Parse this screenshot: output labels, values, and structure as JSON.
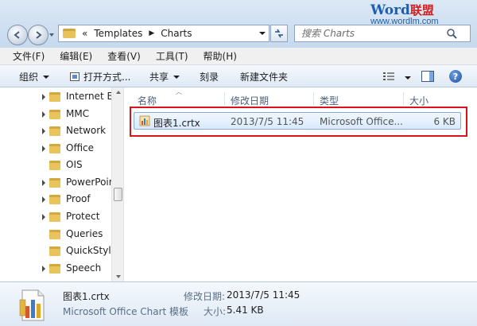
{
  "logo": {
    "brand_word": "Word",
    "brand_cn": "联盟",
    "url": "www.wordlm.com"
  },
  "address": {
    "overflow": "«",
    "crumbs": [
      "Templates",
      "Charts"
    ]
  },
  "search": {
    "placeholder": "搜索 Charts"
  },
  "menu": [
    "文件(F)",
    "编辑(E)",
    "查看(V)",
    "工具(T)",
    "帮助(H)"
  ],
  "toolbar": {
    "organize": "组织",
    "open_with": "打开方式...",
    "share": "共享",
    "burn": "刻录",
    "new_folder": "新建文件夹"
  },
  "nav_items": [
    "Internet Ex",
    "MMC",
    "Network",
    "Office",
    "OIS",
    "PowerPoir",
    "Proof",
    "Protect",
    "Queries",
    "QuickStyle",
    "Speech"
  ],
  "columns": {
    "name": "名称",
    "modified": "修改日期",
    "type": "类型",
    "size": "大小"
  },
  "file": {
    "name": "图表1.crtx",
    "modified": "2013/7/5 11:45",
    "type": "Microsoft Office...",
    "size": "6 KB"
  },
  "details": {
    "file_name": "图表1.crtx",
    "file_type": "Microsoft Office Chart 模板",
    "modified_label": "修改日期:",
    "modified_value": "2013/7/5 11:45",
    "size_label": "大小:",
    "size_value": "5.41 KB"
  },
  "colors": {
    "highlight_border": "#d8141a",
    "selection": "#d9eafc",
    "folder": "#e9c35b"
  }
}
